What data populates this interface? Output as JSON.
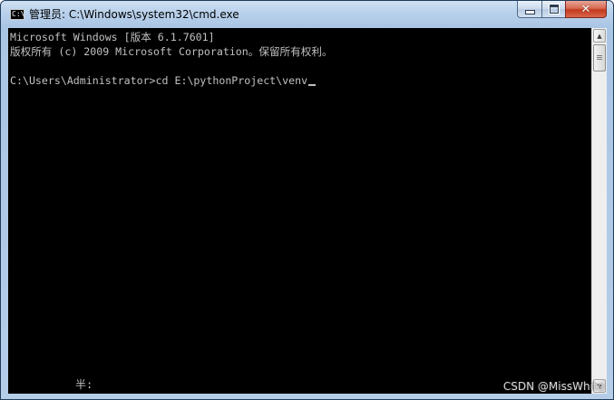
{
  "window": {
    "title": "管理员: C:\\Windows\\system32\\cmd.exe",
    "app_icon_text": "C:\\",
    "buttons": {
      "minimize_icon": "minimize-icon",
      "maximize_icon": "maximize-icon",
      "close_icon": "close-icon",
      "close_glyph": "✕"
    },
    "close_color": "#c23a20"
  },
  "console": {
    "background": "#000000",
    "text_color": "#c0c0c0",
    "lines": [
      "Microsoft Windows [版本 6.1.7601]",
      "版权所有 (c) 2009 Microsoft Corporation。保留所有权利。",
      "C:\\Users\\Administrator>cd E:\\pythonProject\\venv"
    ],
    "ime_status": "半:"
  },
  "scrollbar": {
    "up_glyph": "▲",
    "down_glyph": "▼"
  },
  "watermark": "CSDN @MissWhite"
}
